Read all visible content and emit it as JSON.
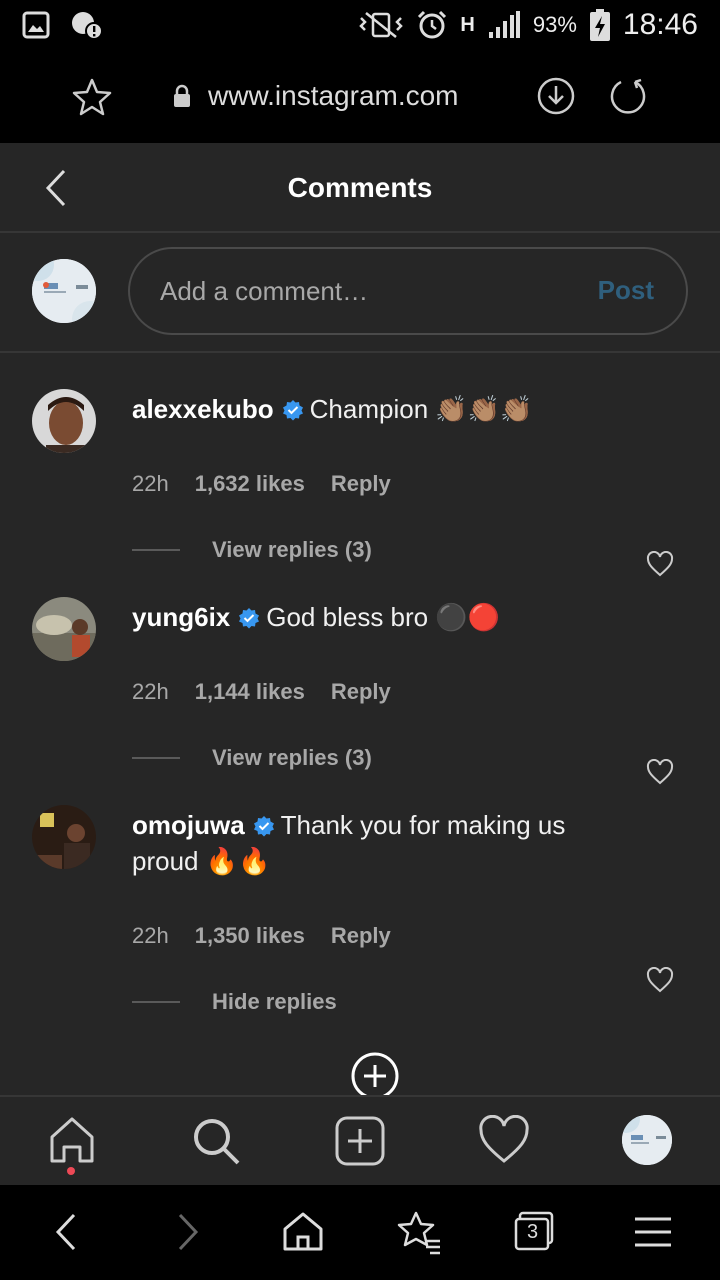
{
  "status_bar": {
    "battery": "93%",
    "time": "18:46",
    "network": "H"
  },
  "browser": {
    "url": "www.instagram.com"
  },
  "header": {
    "title": "Comments"
  },
  "composer": {
    "placeholder": "Add a comment…",
    "post_label": "Post"
  },
  "comments": [
    {
      "username": "alexxekubo",
      "text": "Champion 👏🏽👏🏽👏🏽",
      "time": "22h",
      "likes": "1,632 likes",
      "reply": "Reply",
      "replies_toggle": "View replies (3)"
    },
    {
      "username": "yung6ix",
      "text": "God bless bro ⚫️🔴",
      "time": "22h",
      "likes": "1,144 likes",
      "reply": "Reply",
      "replies_toggle": "View replies (3)"
    },
    {
      "username": "omojuwa",
      "text": "Thank you for making us proud 🔥🔥",
      "time": "22h",
      "likes": "1,350 likes",
      "reply": "Reply",
      "replies_toggle": "Hide replies"
    }
  ],
  "browser_nav": {
    "tab_count": "3"
  },
  "colors": {
    "background": "#262626",
    "verified": "#3897f0",
    "post_disabled": "#2f5f7d",
    "notification_dot": "#ed4956"
  }
}
